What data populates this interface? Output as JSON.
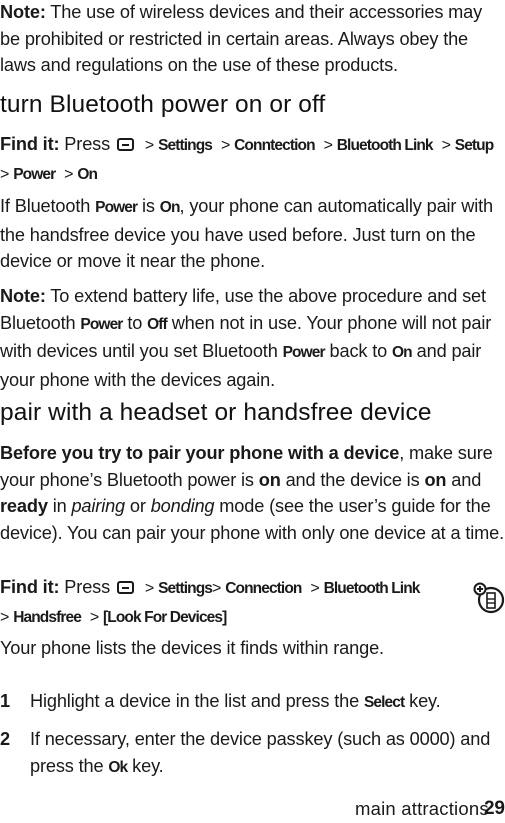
{
  "note1": {
    "label": "Note:",
    "text": " The use of wireless devices and their accessories may be prohibited or restricted in certain areas. Always obey the laws and regulations on the use of these products."
  },
  "section1": {
    "heading": "turn Bluetooth power on or off",
    "find_it": {
      "label": "Find it:",
      "press": " Press",
      "key_icon": "menu-key-icon",
      "path": [
        "Settings",
        "Conntection",
        "Bluetooth Link",
        "Setup",
        "Power",
        "On"
      ]
    },
    "para": {
      "t1": "If Bluetooth ",
      "k1": "Power",
      "t2": " is ",
      "k2": "On",
      "t3": ", your phone can automatically pair with the handsfree device you have used before. Just turn on the device or move it near the phone."
    },
    "note": {
      "label": "Note:",
      "t1": " To extend battery life, use the above procedure and set Bluetooth ",
      "k1": "Power",
      "t2": " to ",
      "k2": "Off",
      "t3": " when not in use. Your phone will not pair with devices until you set Bluetooth ",
      "k3": "Power",
      "t4": " back to ",
      "k4": "On",
      "t5": " and pair your phone with the devices again."
    }
  },
  "section2": {
    "heading": "pair with a headset or handsfree device",
    "intro": {
      "bold_lead": "Before you try to pair your phone with a device",
      "t1": ", make sure your phone’s Bluetooth power is ",
      "b1": "on",
      "t2": " and the device is ",
      "b2": "on",
      "t3": " and ",
      "b3": "ready",
      "t4": " in ",
      "i1": "pairing",
      "t5": "  or ",
      "i2": "bonding",
      "t6": "  mode (see the user’s guide for the device). You can pair your phone with only one device at a time."
    },
    "find_it": {
      "label": "Find it:",
      "press": " Press",
      "key_icon": "menu-key-icon",
      "path": [
        "Settings",
        "Connection",
        "Bluetooth Link",
        "Handsfree",
        "[Look For Devices]"
      ]
    },
    "side_icon": "feature-availability-icon",
    "result_text": "Your phone lists the devices it finds within range.",
    "steps": [
      {
        "num": "1",
        "t1": "Highlight a device in the list and press the ",
        "k1": "Select",
        "t2": " key."
      },
      {
        "num": "2",
        "t1": "If necessary, enter the device passkey (such as 0000) and press the ",
        "k1": "Ok",
        "t2": " key."
      }
    ]
  },
  "footer": {
    "section_label": "main attractions",
    "page_number": "29"
  }
}
